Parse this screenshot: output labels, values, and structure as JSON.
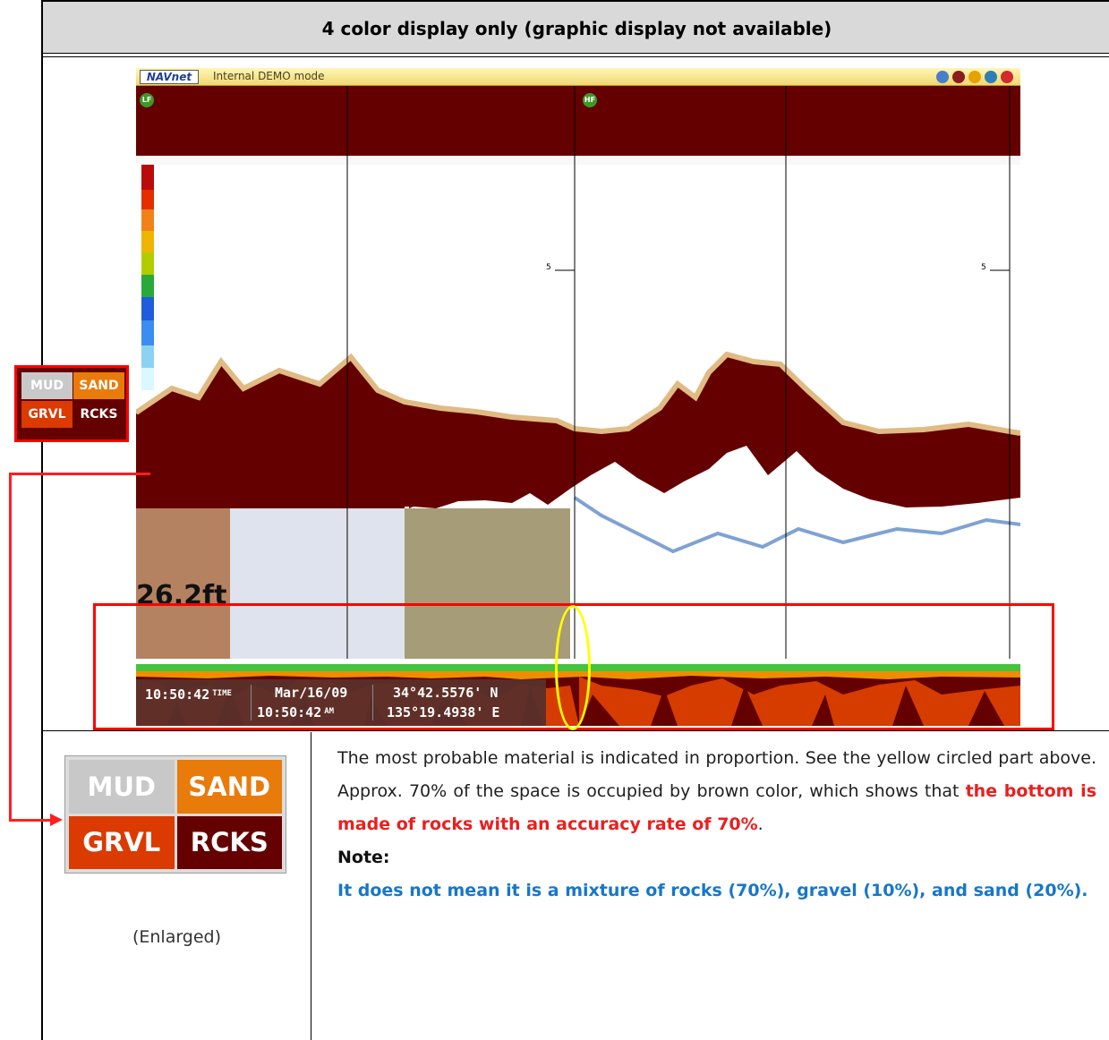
{
  "header": {
    "title": "4 color display only (graphic display not available)"
  },
  "app": {
    "logo": "NAVnet",
    "mode_label": "Internal DEMO mode",
    "badges": [
      "LF",
      "HF"
    ],
    "ticks": [
      "5",
      "5"
    ],
    "depth": "26.2ft",
    "status": {
      "time": "10:50:42",
      "time_label_top": "TIME",
      "time_label_bottom": "AM",
      "date": "Mar/16/09",
      "latitude": "34°42.5576' N",
      "longitude": "135°19.4938' E"
    }
  },
  "legend": {
    "items": [
      {
        "label": "MUD",
        "color": "#c8c8c8"
      },
      {
        "label": "SAND",
        "color": "#e97b0a"
      },
      {
        "label": "GRVL",
        "color": "#db3a00"
      },
      {
        "label": "RCKS",
        "color": "#650000"
      }
    ]
  },
  "enlarged_label": "(Enlarged)",
  "description": {
    "p1_before": "The most probable material is indicated in proportion. See the yellow circled part above. Approx. 70% of the space is occupied by brown color, which shows that ",
    "p1_highlight": "the bottom is made of rocks with an accuracy rate of 70%",
    "p1_end": ".",
    "note_label": "Note:",
    "note_text": "It does not mean it is a mixture of rocks (70%), gravel (10%), and sand (20%)."
  },
  "colors": {
    "sonar_bottom": "#650000",
    "callout": "#ff0000",
    "highlight_circle": "#ffff00",
    "sand": "#e97b0a",
    "gravel": "#db3a00"
  }
}
